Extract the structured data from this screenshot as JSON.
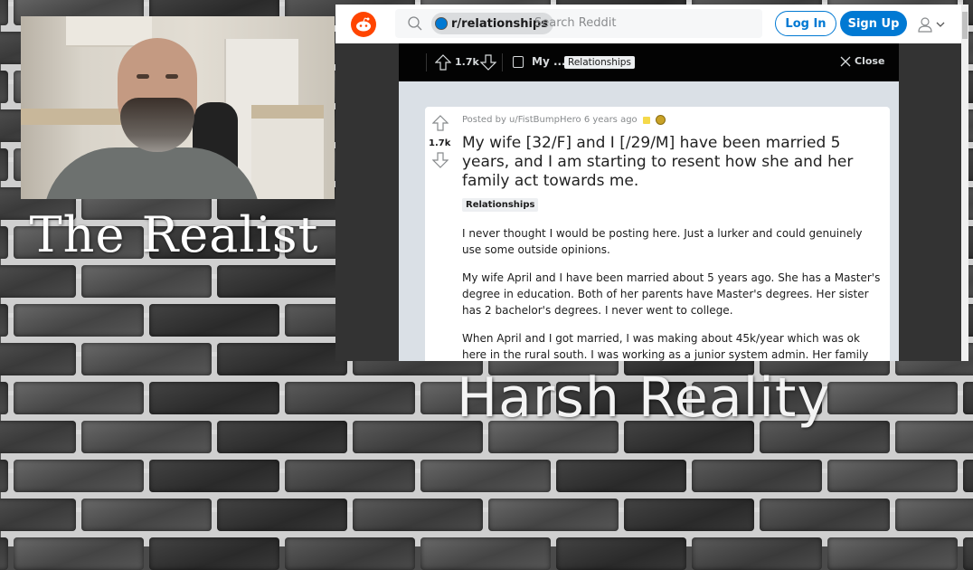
{
  "overlay_captions": {
    "left_title": "The Realist",
    "bottom_title": "Harsh Reality"
  },
  "browser": {
    "topbar": {
      "logo": "reddit-logo-icon",
      "search": {
        "icon": "search-icon",
        "subreddit_chip": "r/relationships",
        "placeholder": "Search Reddit"
      },
      "login_label": "Log In",
      "signup_label": "Sign Up",
      "user_menu_icon": "user-icon",
      "user_menu_chevron": "chevron-down-icon"
    },
    "post_overlay_bar": {
      "upvote_icon": "arrow-up-icon",
      "vote_count": "1.7k",
      "downvote_icon": "arrow-down-icon",
      "post_icon": "post-text-icon",
      "title_truncated": "My ...",
      "flair": "Relationships",
      "close_label": "Close"
    },
    "post": {
      "vote_count": "1.7k",
      "posted_by": "Posted by u/FistBumpHero 6 years ago",
      "title": "My wife [32/F] and I [/29/M] have been married 5 years, and I am starting to resent how she and her family act towards me.",
      "flair": "Relationships",
      "body": [
        "I never thought I would be posting here. Just a lurker and could genuinely use some outside opinions.",
        "My wife April and I have been married about 5 years ago. She has a Master's degree in education. Both of her parents have Master's degrees. Her sister has 2 bachelor's degrees. I never went to college.",
        "When April and I got married, I was making about 45k/year which was ok here in the rural south. I was working as a junior system admin. Her family seemed"
      ]
    }
  }
}
